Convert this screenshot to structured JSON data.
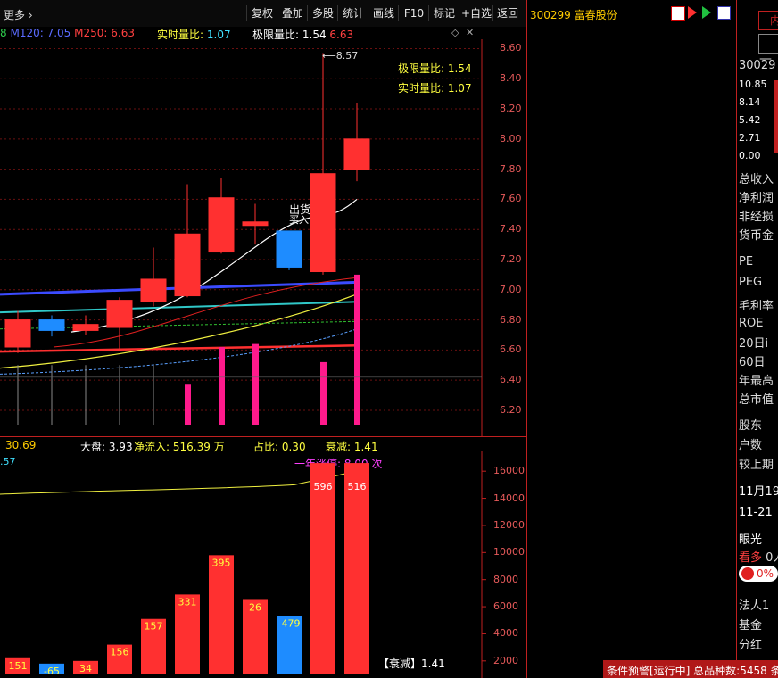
{
  "toolbar": {
    "more": "更多",
    "buttons": [
      "复权",
      "叠加",
      "多股",
      "统计",
      "画线",
      "F10",
      "标记",
      "+自选",
      "返回"
    ],
    "stock_code": "300299",
    "stock_name": "富春股份"
  },
  "ma_line": {
    "prefix": "8",
    "m120": "M120: 7.05",
    "m250": "M250: 6.63",
    "realtime_ratio_label": "实时量比:",
    "realtime_ratio": "1.07",
    "limit_ratio_label": "极限量比:",
    "limit_ratio": "1.54",
    "limit_ratio_2": "6.63"
  },
  "chart_annotations": {
    "high_label": "8.57",
    "limit_ratio_text": "极限量比: 1.54",
    "realtime_ratio_text": "实时量比: 1.07",
    "sell_label": "出货",
    "buy_label": "买入"
  },
  "indicator_bar": {
    "left_value": "30.69",
    "left_value_2": ".57",
    "market": "大盘: 3.93",
    "net_inflow": "净流入: 516.39 万",
    "ratio": "占比: 0.30",
    "decay": "衰减: 1.41",
    "year_limit": "一年涨停: 8.00 次",
    "decay_box": "【衰减】1.41"
  },
  "sidebar": {
    "code_partial": "30029",
    "scale": [
      "10.85",
      "8.14",
      "5.42",
      "2.71",
      "0.00"
    ],
    "fund_labels": [
      "总收入",
      "净利润",
      "非经损",
      "货币金"
    ],
    "val_labels": [
      "PE",
      "PEG",
      "毛利率",
      "ROE"
    ],
    "range_labels": [
      "20日i",
      "60日",
      "年最高",
      "总市值"
    ],
    "share_labels": [
      "股东",
      "户数",
      "较上期"
    ],
    "dates": [
      "11月19",
      "11-21"
    ],
    "vision": "眼光",
    "bull": "看多",
    "bull_count": "0人",
    "percent": "0%",
    "legal": "法人1",
    "fund": "基金",
    "dividend": "分红"
  },
  "status_bar": {
    "text": "条件预警[运行中] 总品种数:5458 条"
  },
  "chart_data": [
    {
      "type": "candlestick",
      "title": "",
      "ylim": [
        6.05,
        8.65
      ],
      "y_ticks": [
        8.6,
        8.4,
        8.2,
        8.0,
        7.8,
        7.6,
        7.4,
        7.2,
        7.0,
        6.8,
        6.6,
        6.4,
        6.2
      ],
      "candles": [
        {
          "open": 6.62,
          "close": 6.8,
          "high": 6.86,
          "low": 6.58,
          "color": "red"
        },
        {
          "open": 6.8,
          "close": 6.73,
          "high": 6.83,
          "low": 6.69,
          "color": "blue"
        },
        {
          "open": 6.73,
          "close": 6.77,
          "high": 6.83,
          "low": 6.7,
          "color": "red"
        },
        {
          "open": 6.75,
          "close": 6.93,
          "high": 6.95,
          "low": 6.61,
          "color": "red"
        },
        {
          "open": 6.92,
          "close": 7.07,
          "high": 7.28,
          "low": 6.89,
          "color": "red"
        },
        {
          "open": 6.96,
          "close": 7.37,
          "high": 7.7,
          "low": 6.95,
          "color": "red"
        },
        {
          "open": 7.25,
          "close": 7.61,
          "high": 7.74,
          "low": 7.24,
          "color": "red"
        },
        {
          "open": 7.45,
          "close": 7.45,
          "high": 7.57,
          "low": 7.3,
          "color": "red"
        },
        {
          "open": 7.39,
          "close": 7.15,
          "high": 7.39,
          "low": 7.13,
          "color": "blue"
        },
        {
          "open": 7.12,
          "close": 7.77,
          "high": 8.57,
          "low": 7.1,
          "color": "red"
        },
        {
          "open": 7.8,
          "close": 8.0,
          "high": 8.24,
          "low": 7.72,
          "color": "red"
        }
      ],
      "moving_averages": [
        {
          "name": "M120",
          "value": 7.05,
          "color": "#3b4bff"
        },
        {
          "name": "M250",
          "value": 6.63,
          "color": "#ff3030"
        }
      ],
      "volume_markers": [
        0,
        0,
        0,
        0,
        0,
        6.37,
        6.62,
        6.64,
        0,
        6.52,
        7.1
      ]
    },
    {
      "type": "bar",
      "title": "",
      "ylim": [
        1000,
        17000
      ],
      "y_ticks": [
        16000,
        14000,
        12000,
        10000,
        8000,
        6000,
        4000,
        2000
      ],
      "labels": [
        "151",
        "-65",
        "34",
        "156",
        "157",
        "331",
        "395",
        "26",
        "-479",
        "596",
        "516"
      ],
      "values": [
        2200,
        1800,
        2000,
        3200,
        5100,
        6900,
        9800,
        6500,
        5300,
        16600,
        16600
      ],
      "colors": [
        "red",
        "blue",
        "red",
        "red",
        "red",
        "red",
        "red",
        "red",
        "blue",
        "red",
        "red"
      ]
    }
  ]
}
